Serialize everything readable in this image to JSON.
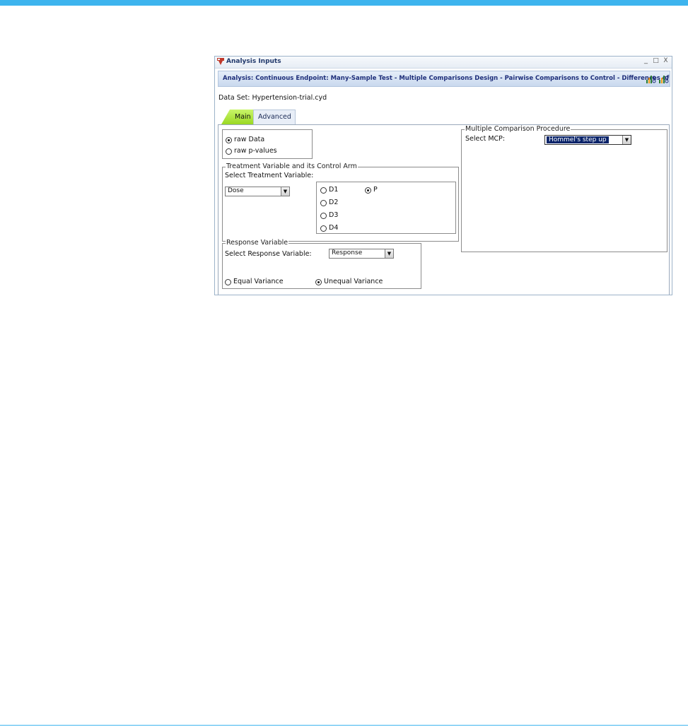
{
  "window": {
    "title": "Analysis Inputs",
    "controls": [
      "_",
      "□",
      "X"
    ]
  },
  "analysis_bar": {
    "text": "Analysis: Continuous Endpoint: Many-Sample Test - Multiple Comparisons Design - Pairwise Comparisons to Control - Differences of Means",
    "icon1": "chart-icon",
    "icon2": "chart-icon"
  },
  "dataset": {
    "label": "Data Set: Hypertension-trial.cyd"
  },
  "tabs": [
    {
      "label": "Main",
      "active": true
    },
    {
      "label": "Advanced",
      "active": false
    }
  ],
  "input_type": {
    "options": [
      {
        "label": "raw Data",
        "selected": true
      },
      {
        "label": "raw p-values",
        "selected": false
      }
    ]
  },
  "treatment": {
    "legend": "Treatment Variable and its Control Arm",
    "select_label": "Select Treatment Variable:",
    "select_value": "Dose",
    "arms": [
      {
        "label": "D1",
        "selected": false
      },
      {
        "label": "D2",
        "selected": false
      },
      {
        "label": "D3",
        "selected": false
      },
      {
        "label": "D4",
        "selected": false
      },
      {
        "label": "P",
        "selected": true
      }
    ]
  },
  "response": {
    "legend": "Response Variable",
    "select_label": "Select Response Variable:",
    "select_value": "Response",
    "variance_options": [
      {
        "label": "Equal Variance",
        "selected": false
      },
      {
        "label": "Unequal Variance",
        "selected": true
      }
    ]
  },
  "mcp": {
    "legend": "Multiple Comparison Procedure",
    "select_label": "Select MCP:",
    "select_value": "Hommel's step up"
  },
  "colors": {
    "accent_stripe": "#3db4ee",
    "active_tab": "#9ad822",
    "selected_value_bg": "#0a246a"
  }
}
